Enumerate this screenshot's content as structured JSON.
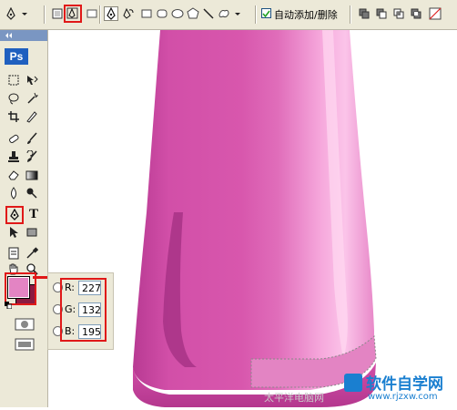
{
  "options_bar": {
    "auto_add_delete_label": "自动添加/删除",
    "auto_add_delete_checked": true
  },
  "toolbox": {
    "logo": "Ps",
    "icons": [
      "marquee-icon",
      "move-icon",
      "lasso-icon",
      "magic-wand-icon",
      "crop-icon",
      "slice-icon",
      "healing-brush-icon",
      "brush-icon",
      "clone-stamp-icon",
      "history-brush-icon",
      "eraser-icon",
      "gradient-icon",
      "blur-icon",
      "dodge-icon",
      "pen-icon",
      "type-icon",
      "path-select-icon",
      "shape-icon",
      "notes-icon",
      "eyedropper-icon",
      "hand-icon",
      "zoom-icon"
    ],
    "foreground_color": "#e384c3",
    "background_color": "#8b1a40"
  },
  "color_panel": {
    "r_label": "R:",
    "g_label": "G:",
    "b_label": "B:",
    "r_value": "227",
    "g_value": "132",
    "b_value": "195"
  },
  "canvas": {
    "object_colors": [
      "#d24fa8",
      "#f29dd6",
      "#b03a8c"
    ]
  },
  "watermark": {
    "site": "太平洋电脑网",
    "brand": "软件自学网",
    "url": "www.rjzxw.com"
  }
}
